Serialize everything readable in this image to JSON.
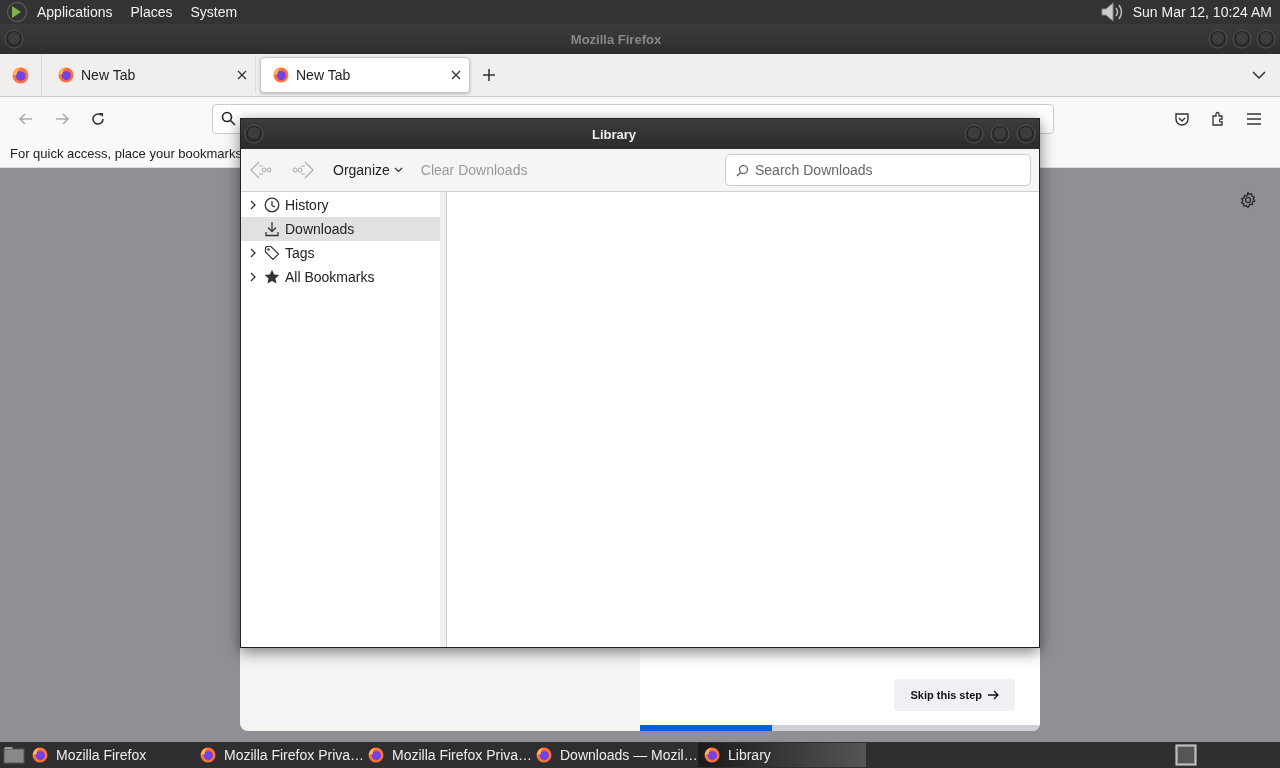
{
  "top_panel": {
    "menus": [
      "Applications",
      "Places",
      "System"
    ],
    "clock": "Sun Mar 12, 10:24 AM"
  },
  "firefox": {
    "title": "Mozilla Firefox",
    "tabs": [
      {
        "label": "New Tab",
        "selected": false
      },
      {
        "label": "New Tab",
        "selected": true
      }
    ],
    "nav": {
      "back_disabled": true,
      "forward_disabled": true
    },
    "bookmarks_hint": "For quick access, place your bookmarks",
    "onboarding": {
      "skip_button": "Skip this step",
      "progress": {
        "level": 0.33
      }
    }
  },
  "library": {
    "title": "Library",
    "toolbar": {
      "back_disabled": true,
      "forward_disabled": true,
      "organize": "Organize",
      "clear_downloads": {
        "label": "Clear Downloads",
        "disabled": true
      },
      "search": {
        "placeholder": "Search Downloads"
      }
    },
    "tree": [
      {
        "kind": "history",
        "label": "History",
        "has_children": true,
        "expanded": false,
        "selected": false
      },
      {
        "kind": "downloads",
        "label": "Downloads",
        "has_children": false,
        "expanded": false,
        "selected": true
      },
      {
        "kind": "tags",
        "label": "Tags",
        "has_children": true,
        "expanded": false,
        "selected": false
      },
      {
        "kind": "bookmarks",
        "label": "All Bookmarks",
        "has_children": true,
        "expanded": false,
        "selected": false
      }
    ]
  },
  "taskbar": {
    "items": [
      {
        "label": "Mozilla Firefox",
        "selected": false
      },
      {
        "label": "Mozilla Firefox Priva…",
        "selected": false
      },
      {
        "label": "Mozilla Firefox Priva…",
        "selected": false
      },
      {
        "label": "Downloads — Mozil…",
        "selected": false
      },
      {
        "label": "Library",
        "selected": true
      }
    ]
  }
}
